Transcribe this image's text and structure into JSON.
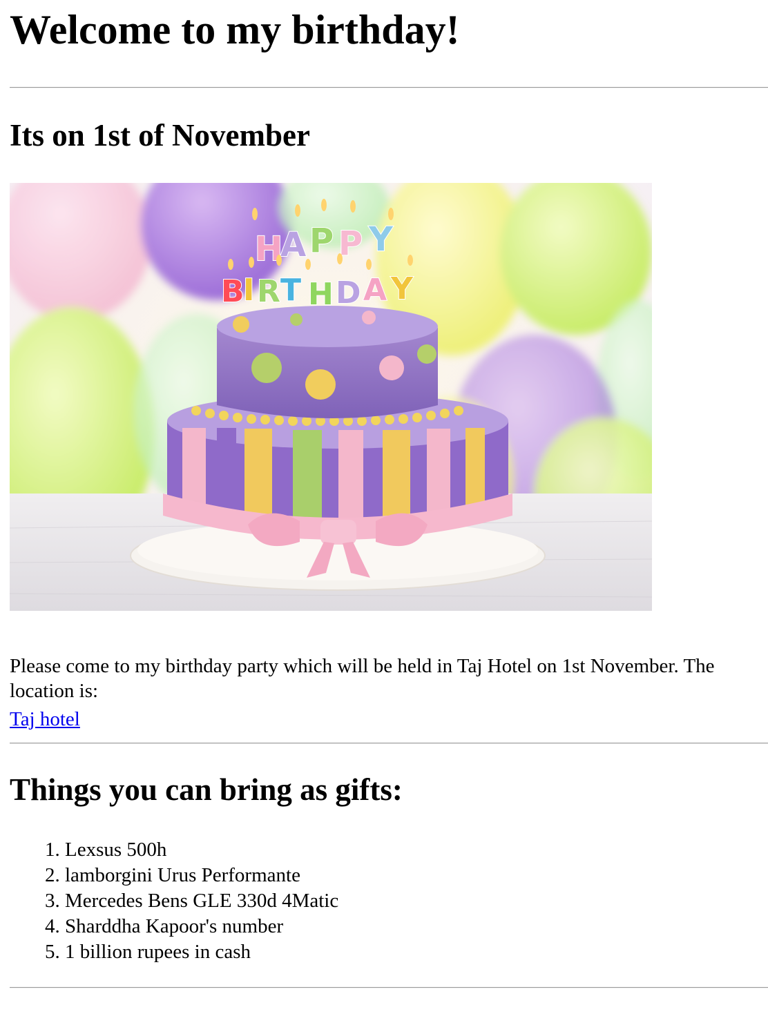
{
  "page": {
    "title": "Welcome to my birthday!",
    "subtitle": "Its on 1st of November",
    "photo": {
      "icon": "birthday-cake-photo",
      "candle_letters_top": "HAPPY",
      "candle_letters_bottom": "BIRTHDAY"
    },
    "invitation": "Please come to my birthday party which will be held in Taj Hotel on 1st November. The location is:",
    "location_link": "Taj hotel",
    "gifts_heading": "Things you can bring as gifts:",
    "gifts": [
      "Lexsus 500h",
      "lamborgini Urus Performante",
      "Mercedes Bens GLE 330d 4Matic",
      "Sharddha Kapoor's number",
      "1 billion rupees in cash"
    ],
    "colors": {
      "link": "#0000ee",
      "rule": "#9a9a9a"
    }
  }
}
